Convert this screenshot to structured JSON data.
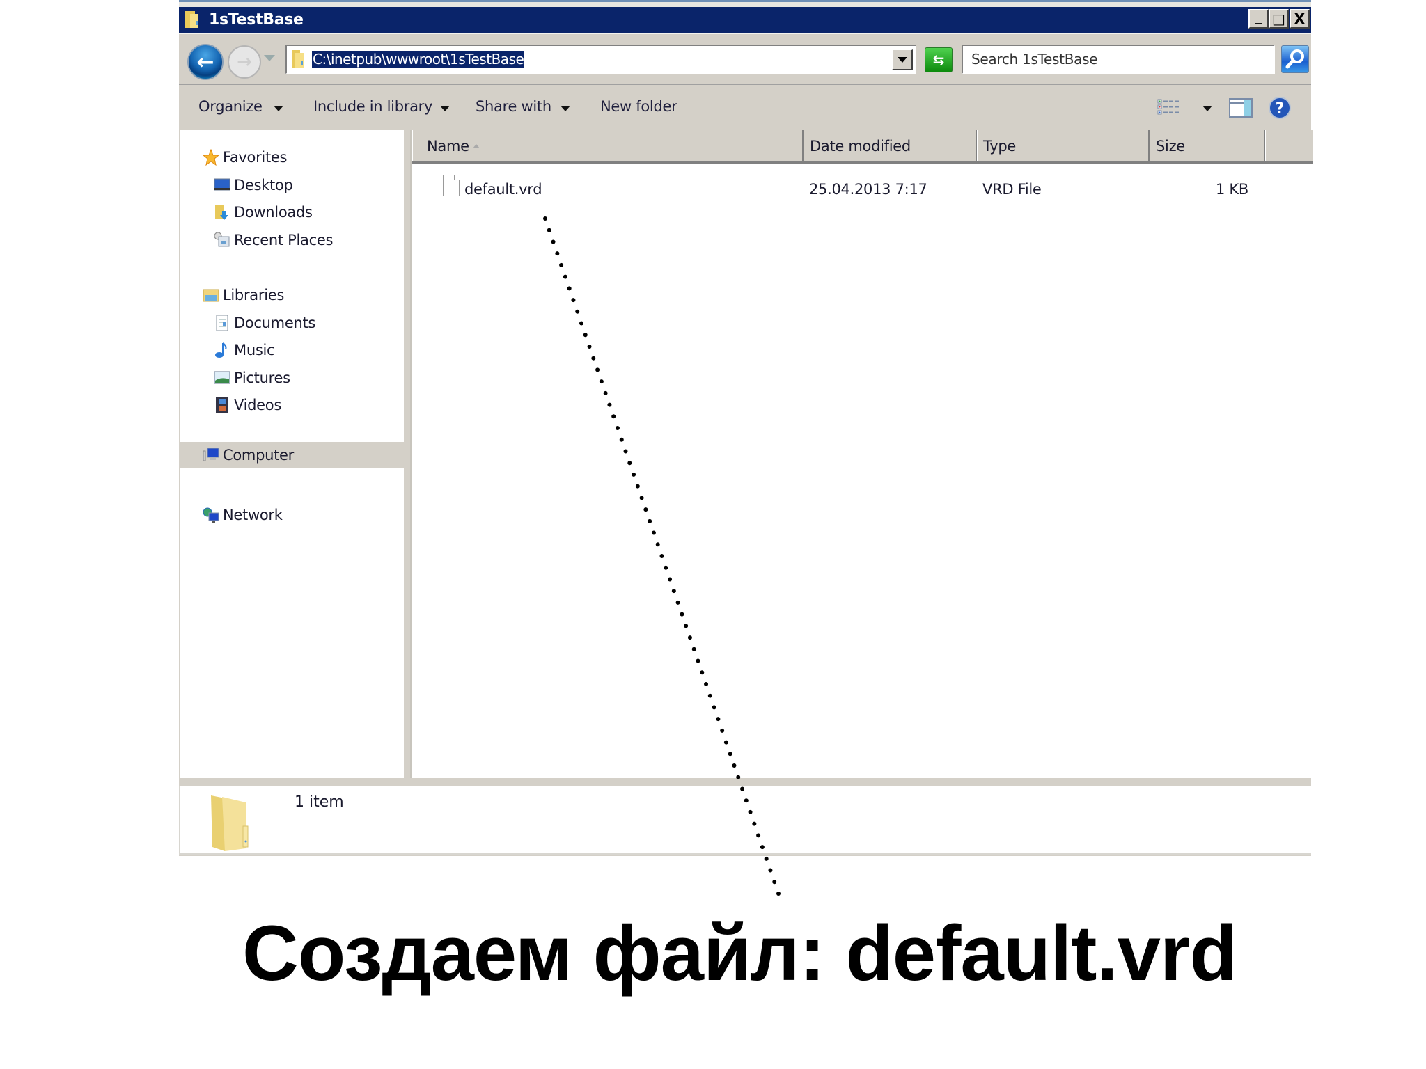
{
  "window": {
    "title": "1sTestBase",
    "controls": {
      "minimize": "_",
      "maximize": "□",
      "close": "X"
    }
  },
  "navigation": {
    "back_icon": "←",
    "forward_icon": "→",
    "address": "C:\\inetpub\\wwwroot\\1sTestBase",
    "refresh_icon": "⇆",
    "search_placeholder": "Search 1sTestBase"
  },
  "toolbar": {
    "organize": "Organize",
    "include_in_library": "Include in library",
    "share_with": "Share with",
    "new_folder": "New folder"
  },
  "sidebar": {
    "items": [
      {
        "label": "Favorites",
        "icon": "star-icon",
        "level": 0
      },
      {
        "label": "Desktop",
        "icon": "desktop-icon",
        "level": 1
      },
      {
        "label": "Downloads",
        "icon": "downloads-icon",
        "level": 1
      },
      {
        "label": "Recent Places",
        "icon": "recent-places-icon",
        "level": 1
      },
      {
        "label": "Libraries",
        "icon": "libraries-icon",
        "level": 0
      },
      {
        "label": "Documents",
        "icon": "documents-icon",
        "level": 1
      },
      {
        "label": "Music",
        "icon": "music-icon",
        "level": 1
      },
      {
        "label": "Pictures",
        "icon": "pictures-icon",
        "level": 1
      },
      {
        "label": "Videos",
        "icon": "videos-icon",
        "level": 1
      },
      {
        "label": "Computer",
        "icon": "computer-icon",
        "level": 0,
        "selected": true
      },
      {
        "label": "Network",
        "icon": "network-icon",
        "level": 0
      }
    ]
  },
  "file_list": {
    "columns": [
      "Name",
      "Date modified",
      "Type",
      "Size"
    ],
    "sort_column": "Name",
    "rows": [
      {
        "name": "default.vrd",
        "date_modified": "25.04.2013 7:17",
        "type": "VRD File",
        "size": "1 KB"
      }
    ]
  },
  "status_bar": {
    "text": "1 item"
  },
  "annotation": {
    "caption": "Создаем файл: default.vrd"
  },
  "colors": {
    "titlebar": "#0a246a",
    "selection": "#0a246a",
    "chrome": "#d4d0c8"
  }
}
